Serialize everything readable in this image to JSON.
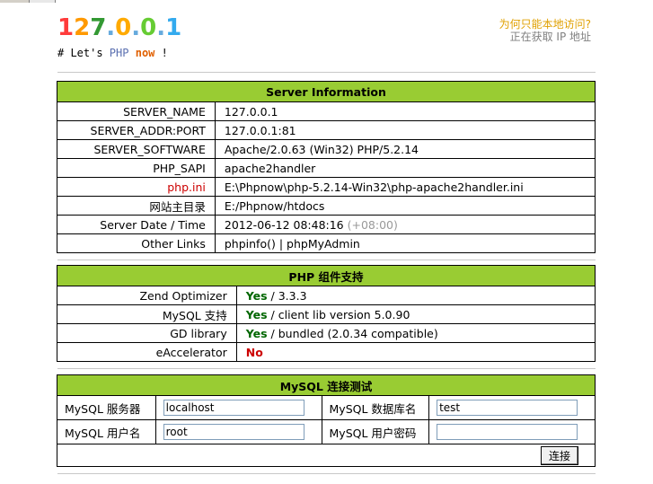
{
  "logo": {
    "chars": [
      {
        "c": "1",
        "color": "#ff3b3b"
      },
      {
        "c": "2",
        "color": "#ff9900"
      },
      {
        "c": "7",
        "color": "#339933"
      },
      {
        "c": ".",
        "color": "#66aadd"
      },
      {
        "c": "0",
        "color": "#ffaa00"
      },
      {
        "c": ".",
        "color": "#66aadd"
      },
      {
        "c": "0",
        "color": "#66cc33"
      },
      {
        "c": ".",
        "color": "#66aadd"
      },
      {
        "c": "1",
        "color": "#33aaee"
      }
    ]
  },
  "tagline": {
    "prefix": "# Let's ",
    "php": "PHP",
    "now": "now",
    "suffix": " !"
  },
  "topright": {
    "why": "为何只能本地访问?",
    "ip": "正在获取 IP 地址"
  },
  "server": {
    "title": "Server Information",
    "rows": [
      {
        "key": "SERVER_NAME",
        "value": "127.0.0.1"
      },
      {
        "key": "SERVER_ADDR:PORT",
        "value": "127.0.0.1:81"
      },
      {
        "key": "SERVER_SOFTWARE",
        "value": "Apache/2.0.63 (Win32) PHP/5.2.14"
      },
      {
        "key": "PHP_SAPI",
        "value": "apache2handler"
      },
      {
        "key": "php.ini",
        "value": "E:\\Phpnow\\php-5.2.14-Win32\\php-apache2handler.ini"
      },
      {
        "key": "网站主目录",
        "value": "E:/Phpnow/htdocs"
      },
      {
        "key": "Server Date / Time",
        "value": "2012-06-12 08:48:16",
        "extra": "(+08:00)"
      },
      {
        "key": "Other Links",
        "link1": "phpinfo()",
        "sep": " | ",
        "link2": "phpMyAdmin"
      }
    ]
  },
  "php_ext": {
    "title": "PHP 组件支持",
    "rows": [
      {
        "key": "Zend Optimizer",
        "status": "Yes",
        "detail": " / 3.3.3"
      },
      {
        "key": "MySQL 支持",
        "status": "Yes",
        "detail": " / client lib version 5.0.90"
      },
      {
        "key": "GD library",
        "status": "Yes",
        "detail": " / bundled (2.0.34 compatible)"
      },
      {
        "key": "eAccelerator",
        "status": "No",
        "detail": ""
      }
    ]
  },
  "mysql": {
    "title": "MySQL 连接测试",
    "server_label": "MySQL 服务器",
    "server_value": "localhost",
    "db_label": "MySQL 数据库名",
    "db_value": "test",
    "user_label": "MySQL 用户名",
    "user_value": "root",
    "pass_label": "MySQL 用户密码",
    "pass_value": "",
    "connect_label": "连接"
  }
}
